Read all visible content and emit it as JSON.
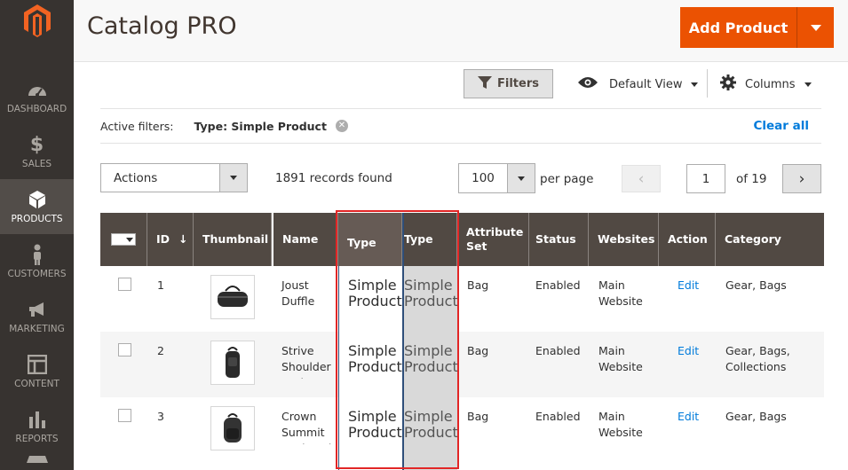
{
  "sidebar": {
    "items": [
      {
        "label": "DASHBOARD",
        "icon": "dashboard-icon"
      },
      {
        "label": "SALES",
        "icon": "dollar-icon"
      },
      {
        "label": "PRODUCTS",
        "icon": "box-icon",
        "active": true
      },
      {
        "label": "CUSTOMERS",
        "icon": "person-icon"
      },
      {
        "label": "MARKETING",
        "icon": "megaphone-icon"
      },
      {
        "label": "CONTENT",
        "icon": "layout-icon"
      },
      {
        "label": "REPORTS",
        "icon": "bar-chart-icon"
      }
    ]
  },
  "header": {
    "title": "Catalog PRO",
    "add_label": "Add Product"
  },
  "toolbar": {
    "filters_label": "Filters",
    "view_label": "Default View",
    "columns_label": "Columns"
  },
  "active_filters": {
    "label": "Active filters:",
    "value": "Type: Simple Product",
    "clear_label": "Clear all"
  },
  "pagination": {
    "actions_label": "Actions",
    "records_found": "1891 records found",
    "per_page_value": "100",
    "per_page_label": "per page",
    "page": "1",
    "of_label": "of 19"
  },
  "grid": {
    "headers": {
      "id": "ID",
      "thumbnail": "Thumbnail",
      "name": "Name",
      "type": "Type",
      "type2": "Type",
      "attribute_set": "Attribute Set",
      "status": "Status",
      "websites": "Websites",
      "action": "Action",
      "category": "Category"
    },
    "rows": [
      {
        "id": "1",
        "name": "Joust Duffle Bag",
        "type": "Simple Product",
        "type2": "Simple Product",
        "attribute_set": "Bag",
        "status": "Enabled",
        "websites": "Main Website",
        "action": "Edit",
        "category": "Gear, Bags"
      },
      {
        "id": "2",
        "name": "Strive Shoulder Pack",
        "type": "Simple Product",
        "type2": "Simple Product",
        "attribute_set": "Bag",
        "status": "Enabled",
        "websites": "Main Website",
        "action": "Edit",
        "category": "Gear, Bags, Collections"
      },
      {
        "id": "3",
        "name": "Crown Summit Backpack",
        "type": "Simple Product",
        "type2": "Simple Product",
        "attribute_set": "Bag",
        "status": "Enabled",
        "websites": "Main Website",
        "action": "Edit",
        "category": "Gear, Bags"
      }
    ]
  },
  "colors": {
    "accent": "#eb5202",
    "sidebar": "#373330",
    "grid_header": "#514943",
    "link": "#007bdb",
    "highlight_border": "#e22626"
  }
}
